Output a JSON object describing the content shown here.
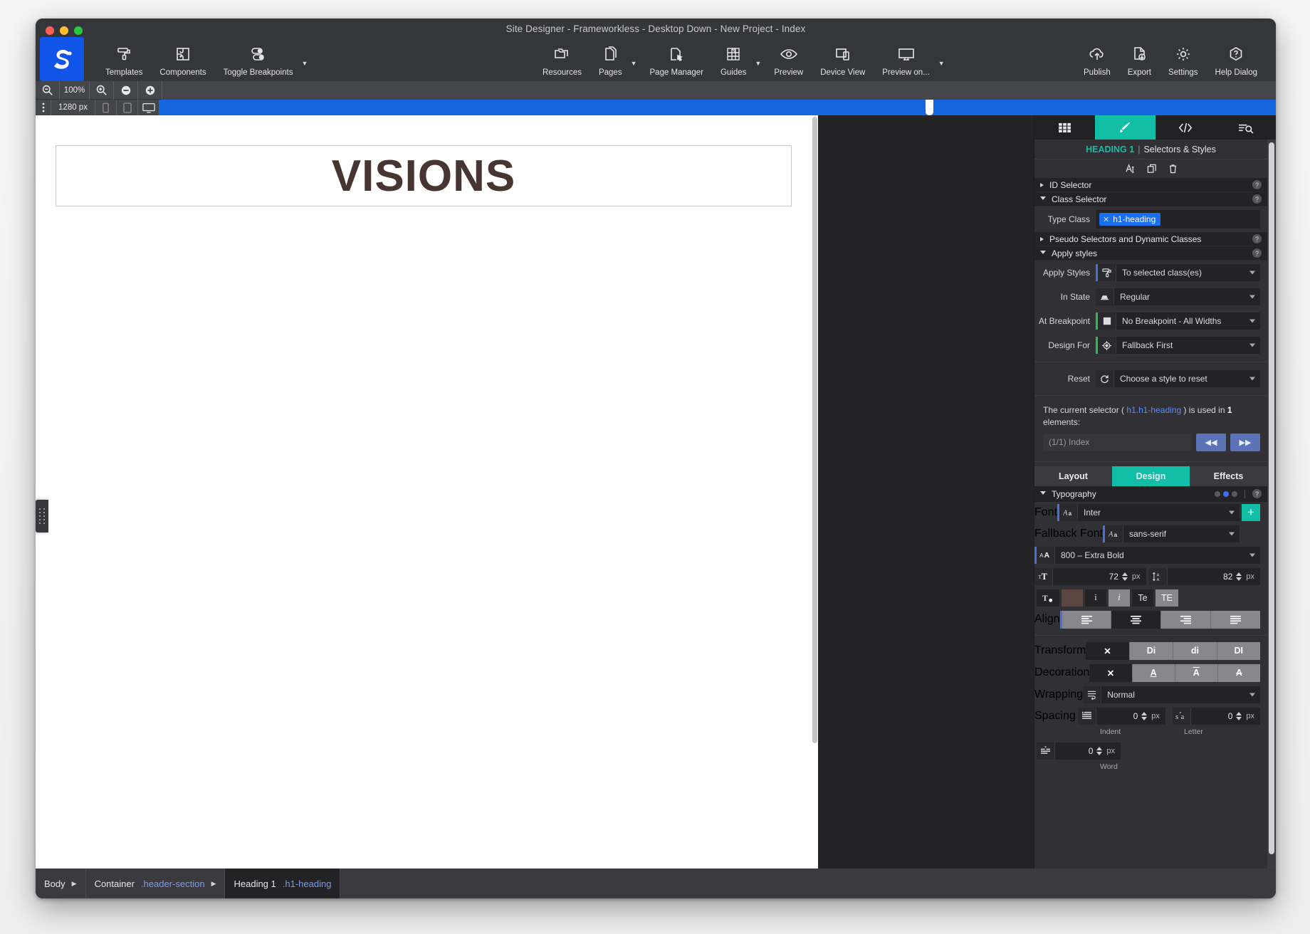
{
  "window": {
    "title": "Site Designer - Frameworkless - Desktop Down - New Project - Index",
    "logo_alt": "site-designer-logo"
  },
  "toolbar": {
    "left": [
      {
        "label": "Templates",
        "icon": "paint-roller-icon"
      },
      {
        "label": "Components",
        "icon": "puzzle-icon"
      },
      {
        "label": "Toggle Breakpoints",
        "icon": "toggles-icon",
        "caret": true
      }
    ],
    "center": [
      {
        "label": "Resources",
        "icon": "folders-icon"
      },
      {
        "label": "Pages",
        "icon": "pages-icon",
        "caret": true
      },
      {
        "label": "Page Manager",
        "icon": "page-manager-icon"
      },
      {
        "label": "Guides",
        "icon": "guides-grid-icon",
        "caret": true
      },
      {
        "label": "Preview",
        "icon": "eye-icon"
      },
      {
        "label": "Device View",
        "icon": "devices-icon"
      },
      {
        "label": "Preview on...",
        "icon": "monitor-icon",
        "caret": true
      }
    ],
    "right": [
      {
        "label": "Publish",
        "icon": "cloud-upload-icon"
      },
      {
        "label": "Export",
        "icon": "file-download-icon"
      },
      {
        "label": "Settings",
        "icon": "gear-icon"
      },
      {
        "label": "Help Dialog",
        "icon": "help-hexagon-icon"
      }
    ]
  },
  "zoombar": {
    "zoom_out_icon": "magnifier-minus-icon",
    "zoom_level": "100%",
    "zoom_in_icon": "magnifier-plus-icon",
    "minus_icon": "circle-minus-icon",
    "plus_icon": "circle-plus-icon"
  },
  "rulerbar": {
    "grip_icon": "vertical-dots-icon",
    "width_value": "1280 px",
    "devices": [
      "phone-icon",
      "tablet-icon",
      "desktop-icon"
    ],
    "active_device": "desktop-icon"
  },
  "canvas": {
    "heading_text": "VISIONS",
    "heading_color": "#463530",
    "section_border_color": "#c9c9cc"
  },
  "inspector": {
    "tabs": [
      {
        "icon": "grid-icon",
        "active": false
      },
      {
        "icon": "paintbrush-icon",
        "active": true
      },
      {
        "icon": "code-icon",
        "active": false
      },
      {
        "icon": "list-search-icon",
        "active": false
      }
    ],
    "context_title": {
      "element": "HEADING 1",
      "separator": "|",
      "panel": "Selectors & Styles"
    },
    "tool_icons": [
      "text-cursor-icon",
      "duplicate-icon",
      "trash-icon"
    ],
    "sections": {
      "id_selector": {
        "label": "ID Selector",
        "expanded": false
      },
      "class_selector": {
        "label": "Class Selector",
        "expanded": true
      },
      "pseudo_selectors": {
        "label": "Pseudo Selectors and Dynamic Classes",
        "expanded": false
      },
      "apply_styles": {
        "label": "Apply styles",
        "expanded": true
      }
    },
    "type_class": {
      "label": "Type Class",
      "chip": "h1-heading",
      "remove_icon": "x-icon"
    },
    "apply": {
      "apply_styles": {
        "label": "Apply Styles",
        "value": "To selected class(es)",
        "icon": "paint-roller-icon"
      },
      "in_state": {
        "label": "In State",
        "value": "Regular",
        "icon": "state-icon"
      },
      "at_breakpoint": {
        "label": "At Breakpoint",
        "value": "No Breakpoint - All Widths",
        "icon": "breakpoint-icon"
      },
      "design_for": {
        "label": "Design For",
        "value": "Fallback First",
        "icon": "target-icon"
      },
      "reset": {
        "label": "Reset",
        "value": "Choose a style to reset",
        "icon": "reset-circle-icon"
      }
    },
    "usage": {
      "prefix": "The current selector (",
      "selector": "h1.h1-heading",
      "middle": ") is used in",
      "count": "1",
      "suffix": "elements:",
      "element_select": "(1/1) Index",
      "prev_label": "◀◀",
      "next_label": "▶▶"
    },
    "style_tabs": [
      {
        "label": "Layout",
        "active": false
      },
      {
        "label": "Design",
        "active": true
      },
      {
        "label": "Effects",
        "active": false
      }
    ],
    "typography": {
      "section_label": "Typography",
      "dots": [
        false,
        true,
        false
      ],
      "font": {
        "label": "Font",
        "value": "Inter",
        "icon": "font-icon",
        "add_label": "+"
      },
      "fallback_font": {
        "label": "Fallback Font",
        "value": "sans-serif",
        "icon": "font-icon"
      },
      "weight": {
        "value": "800 – Extra Bold",
        "icon": "weight-icon"
      },
      "size": {
        "value": "72",
        "unit": "px",
        "icon": "font-size-icon"
      },
      "line_height": {
        "value": "82",
        "unit": "px",
        "icon": "line-height-icon"
      },
      "color_icon": "text-color-icon",
      "color_swatch": "#5a4540",
      "style_buttons": [
        {
          "label": "i",
          "name": "italic-normal-button",
          "selected": false
        },
        {
          "label": "i",
          "name": "italic-button",
          "selected": true
        },
        {
          "label": "Te",
          "name": "text-case-button",
          "selected": false
        },
        {
          "label": "TE",
          "name": "small-caps-button",
          "selected": true
        }
      ],
      "align": {
        "label": "Align",
        "options": [
          "align-left-icon",
          "align-center-icon",
          "align-right-icon",
          "align-justify-icon"
        ],
        "selected_index": 1
      },
      "transform": {
        "label": "Transform",
        "options": [
          "✕",
          "Di",
          "di",
          "DI"
        ],
        "selected_index": 0
      },
      "decoration": {
        "label": "Decoration",
        "options": [
          "✕",
          "A",
          "A",
          "A"
        ],
        "option_names": [
          "none-icon",
          "underline-icon",
          "overline-icon",
          "line-through-icon"
        ],
        "selected_index": 0
      },
      "wrapping": {
        "label": "Wrapping",
        "value": "Normal",
        "icon": "wrap-icon"
      },
      "spacing": {
        "label": "Spacing",
        "indent": {
          "value": "0",
          "unit": "px",
          "sublabel": "Indent",
          "icon": "indent-icon"
        },
        "letter": {
          "value": "0",
          "unit": "px",
          "sublabel": "Letter",
          "icon": "letter-spacing-icon"
        },
        "word": {
          "value": "0",
          "unit": "px",
          "sublabel": "Word",
          "icon": "word-spacing-icon"
        }
      }
    }
  },
  "breadcrumb": [
    {
      "name": "Body",
      "cls": "",
      "active": false,
      "arrow": "▶"
    },
    {
      "name": "Container",
      "cls": ".header-section",
      "active": false,
      "arrow": "▶"
    },
    {
      "name": "Heading 1",
      "cls": ".h1-heading",
      "active": true,
      "arrow": ""
    }
  ]
}
